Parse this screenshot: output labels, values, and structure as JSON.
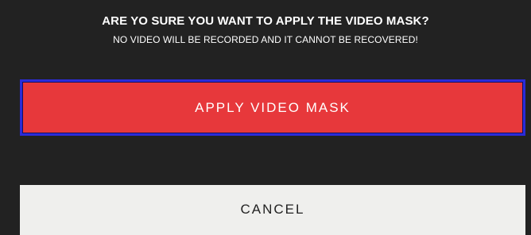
{
  "dialog": {
    "title": "ARE YO SURE YOU WANT TO APPLY THE VIDEO MASK?",
    "subtitle": "NO VIDEO WILL BE RECORDED AND IT CANNOT BE RECOVERED!",
    "apply_label": "APPLY VIDEO MASK",
    "cancel_label": "CANCEL"
  },
  "colors": {
    "background": "#222222",
    "apply_button": "#e7383b",
    "apply_focus_border": "#2b2bd9",
    "cancel_button": "#efefed"
  }
}
